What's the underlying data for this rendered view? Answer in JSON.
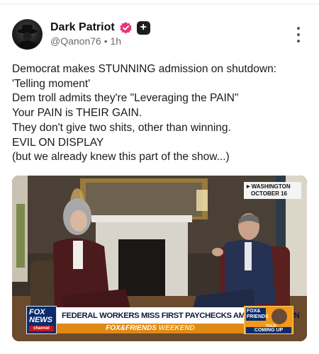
{
  "author": {
    "name": "Dark Patriot",
    "handle": "@Qanon76",
    "separator": "•",
    "time": "1h",
    "verified_icon": "verified-badge-icon",
    "extra_badge_icon": "plus-badge-icon",
    "plus_glyph": "+"
  },
  "menu": {
    "icon": "more-vertical-icon"
  },
  "post": {
    "lines": [
      "Democrat makes STUNNING admission on shutdown:",
      "'Telling moment'",
      "Dem troll admits they're \"Leveraging the PAIN\"",
      "Your PAIN is THEIR GAIN.",
      "They don't give two shits, other than winning.",
      "EVIL ON DISPLAY",
      "(but we already knew this part of the show...)"
    ]
  },
  "media": {
    "location_line1": "WASHINGTON",
    "location_line2": "OCTOBER 16",
    "network_logo_line1": "FOX",
    "network_logo_line2": "NEWS",
    "network_logo_line3": "channel",
    "headline": "FEDERAL WORKERS MISS FIRST PAYCHECKS AMID SHUTDOWN",
    "show_name": "FOX&FRIENDS",
    "show_suffix": "WEEKEND",
    "promo_logo_line1": "FOX&",
    "promo_logo_line2": "FRIENDS",
    "promo_guest": "TULSI GABBARD",
    "promo_label": "COMING UP"
  },
  "colors": {
    "verified": "#e8357a",
    "fox_blue": "#0b2b6b",
    "fox_orange": "#e08a16"
  }
}
